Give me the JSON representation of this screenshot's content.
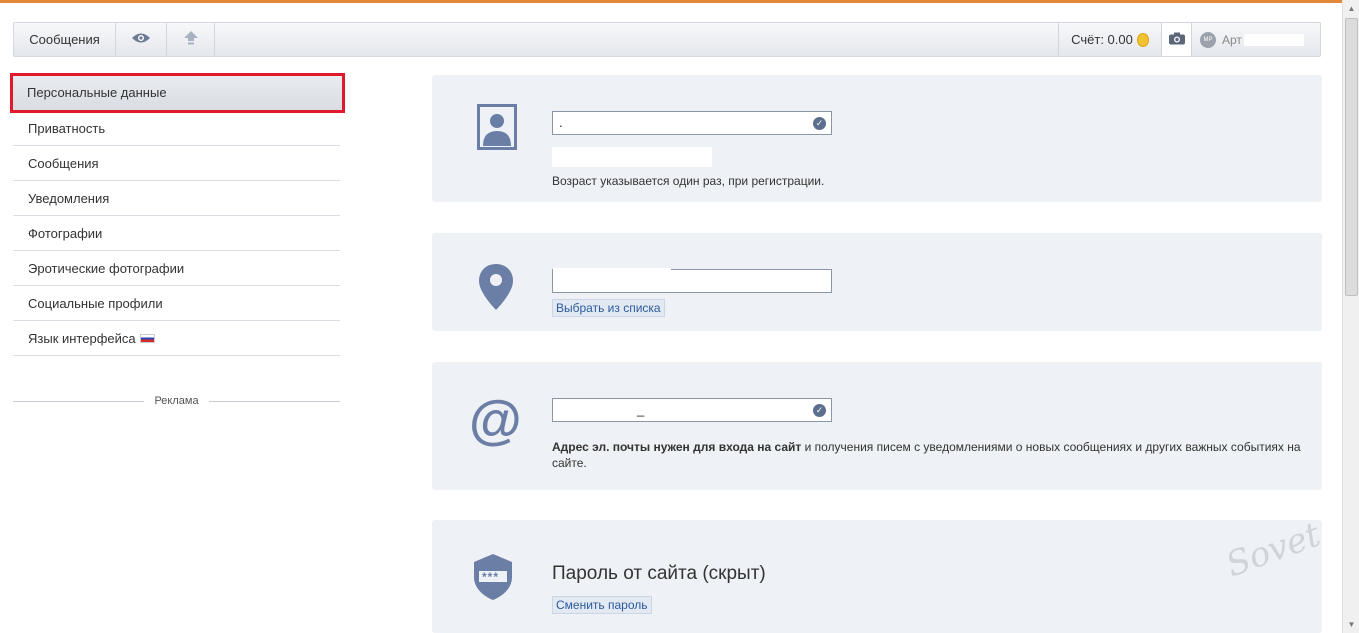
{
  "toolbar": {
    "messages_label": "Сообщения",
    "score_label": "Счёт: 0.00",
    "user_badge": "MP",
    "user_name": "Арт"
  },
  "sidebar": {
    "items": [
      {
        "label": "Персональные данные",
        "active": true
      },
      {
        "label": "Приватность"
      },
      {
        "label": "Сообщения"
      },
      {
        "label": "Уведомления"
      },
      {
        "label": "Фотографии"
      },
      {
        "label": "Эротические фотографии"
      },
      {
        "label": "Социальные профили"
      },
      {
        "label": "Язык интерфейса"
      }
    ],
    "ad_label": "Реклама"
  },
  "profile": {
    "name_value": ".",
    "age_hint": "Возраст указывается один раз, при регистрации."
  },
  "location": {
    "city_value": "",
    "choose_link": "Выбрать из списка"
  },
  "email": {
    "email_value": "_",
    "hint_bold": "Адрес эл. почты нужен для входа на сайт",
    "hint_rest": " и получения писем с уведомлениями о новых сообщениях и других важных событиях на сайте."
  },
  "password": {
    "title": "Пароль от сайта (скрыт)",
    "change_link": "Сменить пароль",
    "icon_text": "***"
  },
  "watermark": "Sovet",
  "colors": {
    "accent": "#e0893a",
    "highlight": "#e0192c",
    "icon": "#6a7ea6",
    "card_bg": "#eef1f5",
    "link": "#2a5a9c"
  }
}
